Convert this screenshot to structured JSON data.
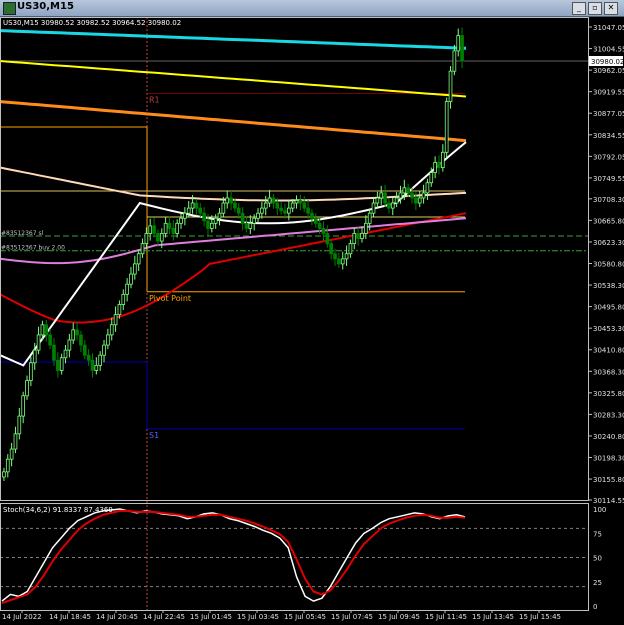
{
  "window": {
    "title": "US30,M15",
    "buttons": [
      "minimize",
      "maximize",
      "close"
    ]
  },
  "main_panel": {
    "header": "US30,M15  30980.52 30982.52 30964.52 30980.02",
    "current_price_label": "30980.02",
    "price_ticks": [
      "31047.05",
      "31004.55",
      "30962.05",
      "30919.55",
      "30877.05",
      "30834.55",
      "30792.05",
      "30749.55",
      "30708.30",
      "30665.80",
      "30623.30",
      "30580.80",
      "30538.30",
      "30495.80",
      "30453.30",
      "30410.80",
      "30368.30",
      "30325.80",
      "30283.30",
      "30240.80",
      "30198.30",
      "30155.80",
      "30114.55"
    ],
    "pivot_labels": {
      "r1": "R1",
      "pp": "Pivot Point",
      "s1": "S1"
    },
    "order_labels": [
      "#83512367 sl",
      "#83512367 buy 2.00"
    ]
  },
  "stoch_panel": {
    "header": "Stoch(34,6,2) 91.8337 87.4369",
    "ticks": [
      "100",
      "75",
      "50",
      "25",
      "0"
    ]
  },
  "time_axis": [
    "14 Jul 2022",
    "14 Jul 18:45",
    "14 Jul 20:45",
    "14 Jul 22:45",
    "15 Jul 01:45",
    "15 Jul 03:45",
    "15 Jul 05:45",
    "15 Jul 07:45",
    "15 Jul 09:45",
    "15 Jul 11:45",
    "15 Jul 13:45",
    "15 Jul 15:45"
  ],
  "colors": {
    "background": "#000000",
    "bull_candle": "#7dff7d",
    "bear_candle": "#007f00",
    "ma_cyan": "#19d8e6",
    "ma_yellow": "#ffff00",
    "ma_orange": "#ff8c1a",
    "ma_bisque": "#ffdab9",
    "ma_red": "#e00000",
    "ma_violet": "#e07ee0",
    "ma_white": "#ffffff",
    "pivot_r1": "#7a0000",
    "pivot_pp": "#ffa500",
    "pivot_s1": "#0000b4",
    "stoch_main": "#ffffff",
    "stoch_signal": "#e00000"
  },
  "chart_data": [
    {
      "type": "candlestick",
      "symbol": "US30",
      "timeframe": "M15",
      "ohlc_header": {
        "open": 30980.52,
        "high": 30982.52,
        "low": 30964.52,
        "close": 30980.02
      },
      "current_price": 30980.02,
      "ylim": [
        30114.55,
        31060
      ],
      "pivots": {
        "R1": 30916,
        "Pivot Point": 30525,
        "S1": 30255
      },
      "orders": [
        {
          "label": "#83512367 sl",
          "price": 30635
        },
        {
          "label": "#83512367 buy 2.00",
          "price": 30606
        }
      ],
      "closes": [
        30170,
        30195,
        30215,
        30245,
        30280,
        30320,
        30350,
        30385,
        30410,
        30440,
        30460,
        30440,
        30420,
        30390,
        30370,
        30395,
        30410,
        30430,
        30450,
        30440,
        30420,
        30400,
        30390,
        30370,
        30380,
        30400,
        30420,
        30440,
        30460,
        30480,
        30500,
        30520,
        30540,
        30560,
        30580,
        30600,
        30620,
        30640,
        30655,
        30640,
        30625,
        30640,
        30660,
        30650,
        30640,
        30660,
        30670,
        30680,
        30690,
        30700,
        30690,
        30680,
        30665,
        30650,
        30660,
        30670,
        30680,
        30700,
        30710,
        30700,
        30690,
        30680,
        30660,
        30650,
        30660,
        30670,
        30680,
        30690,
        30700,
        30710,
        30700,
        30690,
        30685,
        30680,
        30690,
        30700,
        30705,
        30700,
        30690,
        30680,
        30670,
        30660,
        30650,
        30640,
        30620,
        30600,
        30590,
        30580,
        30590,
        30600,
        30620,
        30640,
        30630,
        30640,
        30660,
        30680,
        30700,
        30710,
        30720,
        30700,
        30690,
        30700,
        30710,
        30720,
        30730,
        30720,
        30710,
        30700,
        30710,
        30720,
        30740,
        30760,
        30780,
        30770,
        30800,
        30900,
        30960,
        31000,
        31030,
        30980
      ],
      "moving_averages": [
        {
          "color": "#19d8e6",
          "start": 31040,
          "end": 31005
        },
        {
          "color": "#ffff00",
          "start": 30980,
          "end": 30910
        },
        {
          "color": "#ff8c1a",
          "start": 30900,
          "end": 30823
        },
        {
          "color": "#ffdab9",
          "start": 30770,
          "end": 30712
        },
        {
          "color": "#e00000",
          "start": 30520,
          "end": 30680
        },
        {
          "color": "#e07ee0",
          "start": 30590,
          "end": 30670
        },
        {
          "color": "#ffffff",
          "start": 30380,
          "end": 30790
        }
      ]
    },
    {
      "type": "line",
      "title": "Stoch(34,6,2)",
      "ylim": [
        0,
        100
      ],
      "levels": [
        80,
        50,
        20
      ],
      "series": [
        {
          "name": "main",
          "color": "#ffffff",
          "values": [
            5,
            12,
            10,
            15,
            30,
            45,
            60,
            70,
            80,
            88,
            92,
            96,
            98,
            99,
            100,
            98,
            96,
            98,
            97,
            95,
            94,
            93,
            90,
            92,
            95,
            96,
            94,
            90,
            88,
            85,
            82,
            78,
            75,
            70,
            60,
            30,
            10,
            5,
            8,
            20,
            35,
            50,
            65,
            75,
            80,
            86,
            90,
            92,
            94,
            96,
            95,
            92,
            90,
            93,
            94,
            92
          ]
        },
        {
          "name": "signal",
          "color": "#e00000",
          "values": [
            3,
            6,
            9,
            12,
            20,
            32,
            46,
            58,
            68,
            78,
            85,
            90,
            94,
            96,
            98,
            98,
            97,
            97,
            97,
            96,
            95,
            94,
            92,
            92,
            93,
            94,
            94,
            92,
            90,
            88,
            85,
            82,
            78,
            74,
            66,
            48,
            28,
            15,
            12,
            16,
            26,
            38,
            52,
            64,
            72,
            80,
            85,
            88,
            91,
            93,
            94,
            93,
            91,
            91,
            92,
            91
          ]
        }
      ]
    }
  ]
}
